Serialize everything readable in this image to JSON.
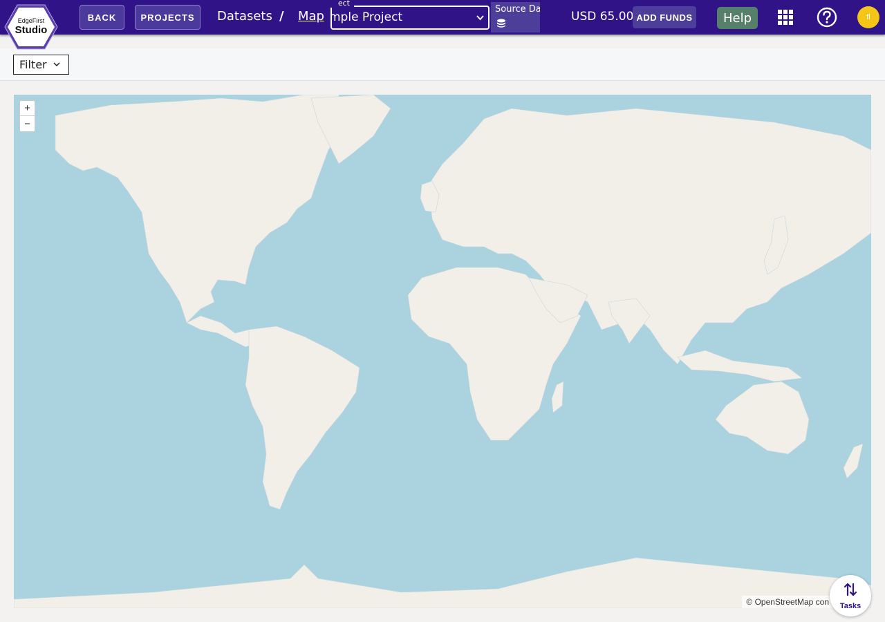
{
  "logo": {
    "line1": "EdgeFirst",
    "line2": "Studio"
  },
  "header": {
    "back_label": "BACK",
    "projects_label": "PROJECTS",
    "breadcrumb": [
      "Datasets",
      "/",
      "Map"
    ],
    "project_field_label": "ect",
    "project_value": "mple Project",
    "source_data_label": "Source Dat",
    "balance": "USD 65.00",
    "add_funds_label": "ADD FUNDS",
    "help_label": "Help",
    "avatar_initials": "fl"
  },
  "filter": {
    "label": "Filter"
  },
  "map": {
    "zoom_in": "+",
    "zoom_out": "−",
    "attribution": "© OpenStreetMap con"
  },
  "tasks": {
    "label": "Tasks"
  },
  "colors": {
    "topbar": "#2f1387",
    "ocean": "#aad3df",
    "land": "#f2efe9",
    "help_button": "#57806a",
    "avatar": "#f5c518"
  }
}
